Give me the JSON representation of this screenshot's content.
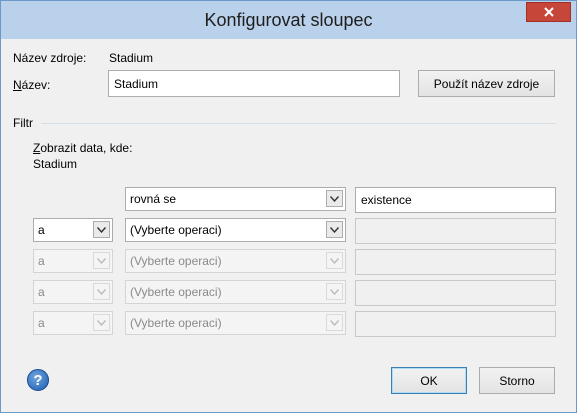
{
  "window": {
    "title": "Konfigurovat sloupec"
  },
  "source": {
    "label": "Název zdroje:",
    "value": "Stadium"
  },
  "name": {
    "label": "Název:",
    "value": "Stadium"
  },
  "use_source_name_button": "Použít název zdroje",
  "filter": {
    "section_label": "Filtr",
    "show_data_label": "Zobrazit data, kde:",
    "column_name": "Stadium",
    "rows": [
      {
        "connector": "",
        "operator": "rovná se",
        "value": "existence",
        "enabled": true
      },
      {
        "connector": "a",
        "operator": "(Vyberte operaci)",
        "value": "",
        "enabled": true
      },
      {
        "connector": "a",
        "operator": "(Vyberte operaci)",
        "value": "",
        "enabled": false
      },
      {
        "connector": "a",
        "operator": "(Vyberte operaci)",
        "value": "",
        "enabled": false
      },
      {
        "connector": "a",
        "operator": "(Vyberte operaci)",
        "value": "",
        "enabled": false
      }
    ]
  },
  "buttons": {
    "ok": "OK",
    "cancel": "Storno"
  },
  "icons": {
    "close": "close-icon",
    "help": "help-icon",
    "dropdown": "chevron-down-icon"
  }
}
